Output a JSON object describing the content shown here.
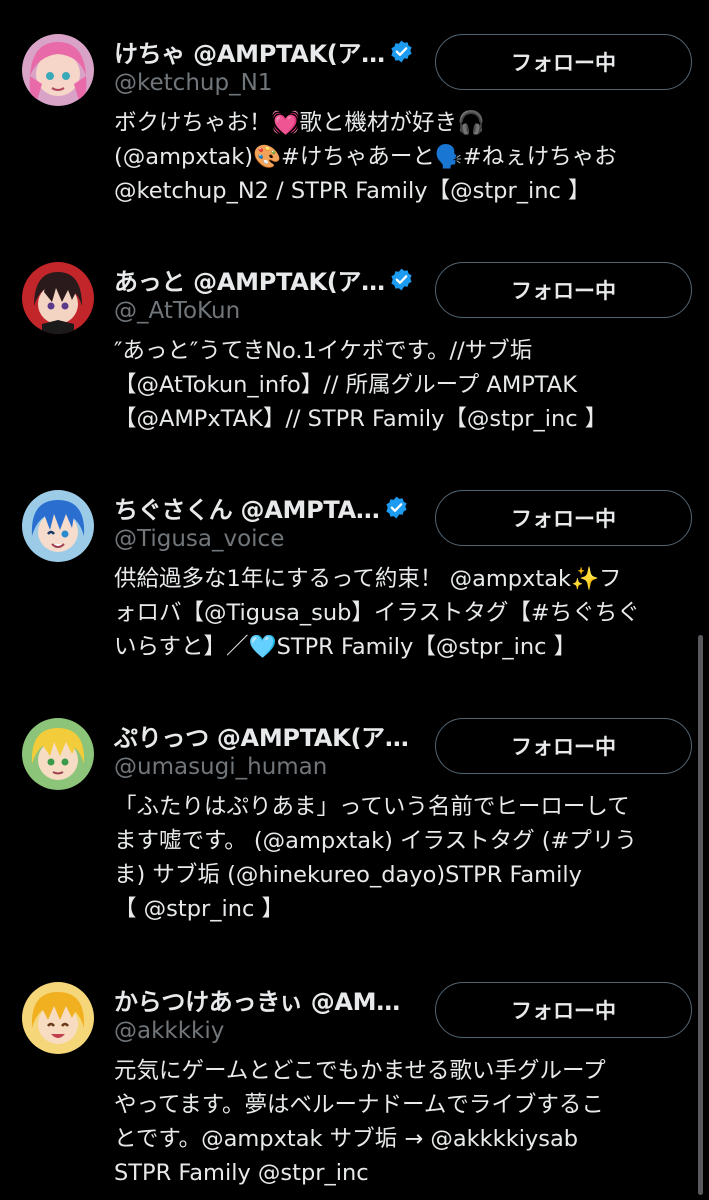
{
  "colors": {
    "background": "#000000",
    "text_primary": "#e7e9ea",
    "text_secondary": "#71767b",
    "verified_badge": "#1d9bf0",
    "button_border": "#536471"
  },
  "users": [
    {
      "display_name": "けちゃ @AMPTAK(ア…",
      "verified": true,
      "handle": "@ketchup_N1",
      "follow_label": "フォロー中",
      "avatar_icon": "avatar-pink-hair-icon",
      "bio_lines": [
        "ボクけちゃお！💓歌と機材が好き🎧",
        "(@ampxtak)🎨#けちゃあーと🗣️#ねぇけちゃお",
        "@ketchup_N2 / STPR Family【@stpr_inc 】"
      ]
    },
    {
      "display_name": "あっと @AMPTAK(ア…",
      "verified": true,
      "handle": "@_AtToKun",
      "follow_label": "フォロー中",
      "avatar_icon": "avatar-dark-hair-red-icon",
      "bio_lines": [
        "″あっと″うてきNo.1イケボです。//サブ垢",
        "【@AtTokun_info】// 所属グループ AMPTAK",
        "【@AMPxTAK】// STPR Family【@stpr_inc 】"
      ]
    },
    {
      "display_name": "ちぐさくん @AMPTA…",
      "verified": true,
      "handle": "@Tigusa_voice",
      "follow_label": "フォロー中",
      "avatar_icon": "avatar-blue-hair-icon",
      "bio_lines": [
        "供給過多な1年にするって約束！ @ampxtak✨フ",
        "ォロバ【@Tigusa_sub】イラストタグ【#ちぐちぐ",
        "いらすと】／🩵STPR Family【@stpr_inc 】"
      ]
    },
    {
      "display_name": "ぷりっつ @AMPTAK(ア…",
      "verified": false,
      "handle": "@umasugi_human",
      "follow_label": "フォロー中",
      "avatar_icon": "avatar-blonde-green-icon",
      "bio_lines": [
        "「ふたりはぷりあま」っていう名前でヒーローして",
        "ます嘘です。 (@ampxtak) イラストタグ (#プリう",
        "ま) サブ垢 (@hinekureo_dayo)STPR Family",
        "【 @stpr_inc 】"
      ]
    },
    {
      "display_name": "からつけあっきぃ @AM…",
      "verified": false,
      "handle": "@akkkkiy",
      "follow_label": "フォロー中",
      "avatar_icon": "avatar-yellow-hair-icon",
      "bio_lines": [
        "元気にゲームとどこでもかませる歌い手グループ",
        "やってます。夢はベルーナドームでライブするこ",
        "とです。@ampxtak サブ垢 → @akkkkiysab",
        "STPR Family @stpr_inc"
      ]
    }
  ]
}
